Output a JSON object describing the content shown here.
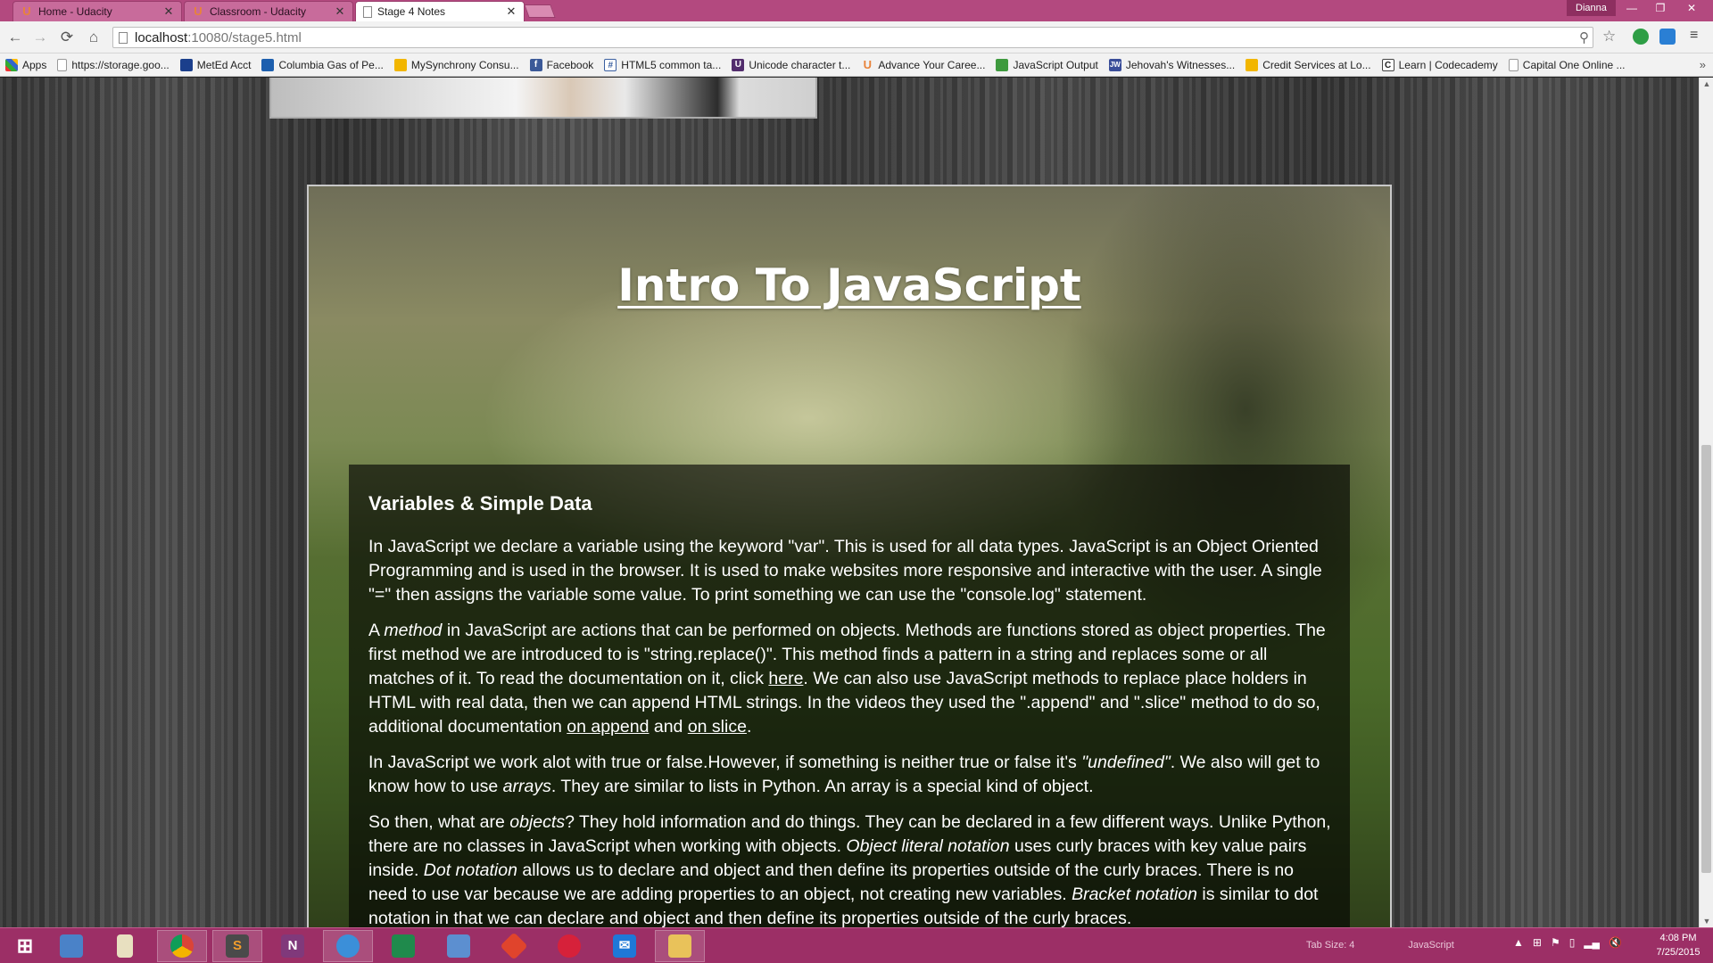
{
  "browser": {
    "tabs": [
      {
        "label": "Home - Udacity",
        "icon": "udacity-icon"
      },
      {
        "label": "Classroom - Udacity",
        "icon": "udacity-icon"
      },
      {
        "label": "Stage 4 Notes",
        "icon": "page-icon",
        "active": true
      }
    ],
    "profile_name": "Dianna",
    "url_host": "localhost",
    "url_rest": ":10080/stage5.html",
    "bookmarks": [
      {
        "label": "Apps",
        "icon": "apps-grid-icon"
      },
      {
        "label": "https://storage.goo...",
        "icon": "page-icon"
      },
      {
        "label": "MetEd Acct",
        "icon": "meted-icon"
      },
      {
        "label": "Columbia Gas of Pe...",
        "icon": "columbia-gas-icon"
      },
      {
        "label": "MySynchrony Consu...",
        "icon": "synchrony-icon"
      },
      {
        "label": "Facebook",
        "icon": "facebook-icon"
      },
      {
        "label": "HTML5 common ta...",
        "icon": "html5-icon"
      },
      {
        "label": "Unicode character t...",
        "icon": "unicode-icon"
      },
      {
        "label": "Advance Your Caree...",
        "icon": "udacity-icon"
      },
      {
        "label": "JavaScript Output",
        "icon": "js-output-icon"
      },
      {
        "label": "Jehovah's Witnesses...",
        "icon": "jw-icon"
      },
      {
        "label": "Credit Services at Lo...",
        "icon": "credit-icon"
      },
      {
        "label": "Learn | Codecademy",
        "icon": "codecademy-icon"
      },
      {
        "label": "Capital One Online ...",
        "icon": "page-icon"
      }
    ],
    "more_bookmarks": "»"
  },
  "page": {
    "title": "Intro To JavaScript",
    "section_heading": "Variables & Simple Data",
    "p1": "In JavaScript we declare a variable using the keyword \"var\". This is used for all data types. JavaScript is an Object Oriented Programming and is used in the browser. It is used to make websites more responsive and interactive with the user. A single \"=\" then assigns the variable some value. To print something we can use the \"console.log\" statement.",
    "p2": {
      "a": "A ",
      "method": "method",
      "b": " in JavaScript are actions that can be performed on objects. Methods are functions stored as object properties. The first method we are introduced to is \"string.replace()\". This method finds a pattern in a string and replaces some or all matches of it. To read the documentation on it, click ",
      "link_here": "here",
      "c": ". We can also use JavaScript methods to replace place holders in HTML with real data, then we can append HTML strings. In the videos they used the \".append\" and \".slice\" method to do so, additional documentation ",
      "link_append": "on append",
      "d": " and ",
      "link_slice": "on slice",
      "e": "."
    },
    "p3": {
      "a": "In JavaScript we work alot with true or false.However, if something is neither true or false it's ",
      "undefined": "\"undefined\"",
      "b": ". We also will get to know how to use ",
      "arrays": "arrays",
      "c": ". They are similar to lists in Python. An array is a special kind of object."
    },
    "p4": {
      "a": "So then, what are ",
      "objects": "objects",
      "b": "? They hold information and do things. They can be declared in a few different ways. Unlike Python, there are no classes in JavaScript when working with objects. ",
      "obj_literal": "Object literal notation",
      "c": " uses curly braces with key value pairs inside. ",
      "dot": "Dot notation",
      "d": " allows us to declare and object and then define its properties outside of the curly braces. There is no need to use var because we are adding properties to an object, not creating new variables. ",
      "bracket": "Bracket notation",
      "e": " is similar to dot notation in that we can declare and object and then define its properties outside of the curly braces."
    }
  },
  "taskbar": {
    "apps": [
      "windows-start-icon",
      "remote-desktop-icon",
      "notepad-icon",
      "chrome-icon",
      "sublime-text-icon",
      "onenote-icon",
      "network-icon",
      "excel-icon",
      "folder-blue-icon",
      "git-icon",
      "alarm-clock-icon",
      "mail-icon",
      "file-explorer-icon"
    ],
    "status_tab_size": "Tab Size: 4",
    "status_syntax": "JavaScript",
    "time": "4:08 PM",
    "date": "7/25/2015"
  }
}
